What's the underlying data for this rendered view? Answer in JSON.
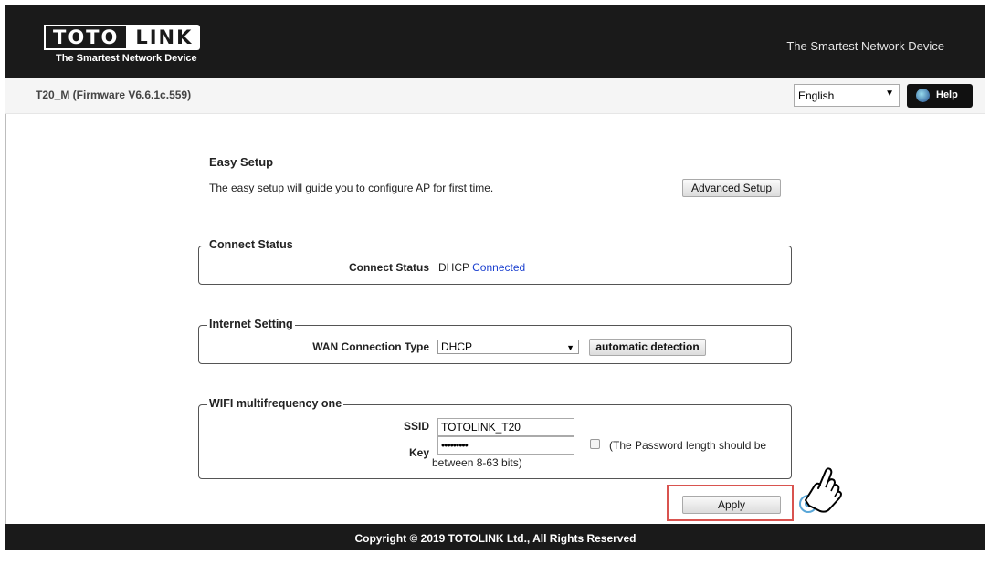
{
  "brand": {
    "logo_left": "TOTO",
    "logo_right": "LINK",
    "logo_sub": "The Smartest Network Device",
    "slogan": "The Smartest Network Device"
  },
  "topbar": {
    "firmware": "T20_M (Firmware V6.6.1c.559)",
    "language": "English",
    "help_label": "Help"
  },
  "easy_setup": {
    "title": "Easy Setup",
    "description": "The easy setup will guide you to configure AP for first time.",
    "advanced_button": "Advanced Setup"
  },
  "connect_status": {
    "legend": "Connect Status",
    "label": "Connect Status",
    "mode": "DHCP",
    "state": "Connected",
    "state_color": "#1a3fcf"
  },
  "internet_setting": {
    "legend": "Internet Setting",
    "wan_label": "WAN Connection Type",
    "wan_value": "DHCP",
    "detect_button": "automatic detection"
  },
  "wifi": {
    "legend": "WIFI multifrequency one",
    "ssid_label": "SSID",
    "ssid_value": "TOTOLINK_T20",
    "key_label": "Key",
    "key_value": "•••••••••",
    "hint_line1": "(The Password length should be",
    "hint_line2": "between 8-63 bits)"
  },
  "actions": {
    "apply_label": "Apply",
    "highlight_color": "#d9534f"
  },
  "footer": {
    "copyright": "Copyright © 2019 TOTOLINK Ltd., All Rights Reserved"
  },
  "icons": [
    "chevron-down-icon",
    "globe-icon",
    "hand-pointer-icon"
  ]
}
